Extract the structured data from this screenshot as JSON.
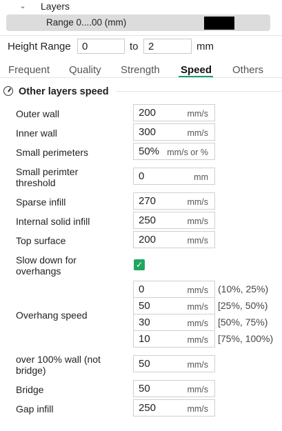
{
  "layers": {
    "title": "Layers",
    "range_label": "Range 0....00 (mm)"
  },
  "height_range": {
    "label": "Height Range",
    "from": "0",
    "to_label": "to",
    "to": "2",
    "unit": "mm"
  },
  "tabs": [
    "Frequent",
    "Quality",
    "Strength",
    "Speed",
    "Others"
  ],
  "active_tab": "Speed",
  "section": {
    "title": "Other layers speed"
  },
  "settings": {
    "outer_wall": {
      "label": "Outer wall",
      "value": "200",
      "unit": "mm/s"
    },
    "inner_wall": {
      "label": "Inner wall",
      "value": "300",
      "unit": "mm/s"
    },
    "small_perimeters": {
      "label": "Small perimeters",
      "value": "50%",
      "unit": "mm/s or %"
    },
    "small_perimeter_threshold": {
      "label_line1": "Small perimter",
      "label_line2": "threshold",
      "value": "0",
      "unit": "mm"
    },
    "sparse_infill": {
      "label": "Sparse infill",
      "value": "270",
      "unit": "mm/s"
    },
    "internal_solid_infill": {
      "label": "Internal solid infill",
      "value": "250",
      "unit": "mm/s"
    },
    "top_surface": {
      "label": "Top surface",
      "value": "200",
      "unit": "mm/s"
    },
    "slow_down_overhangs": {
      "label_line1": "Slow down for",
      "label_line2": "overhangs",
      "checked": true
    },
    "overhang_speed": {
      "label": "Overhang speed",
      "rows": [
        {
          "value": "0",
          "unit": "mm/s",
          "range": "(10%, 25%)"
        },
        {
          "value": "50",
          "unit": "mm/s",
          "range": "[25%, 50%)"
        },
        {
          "value": "30",
          "unit": "mm/s",
          "range": "[50%, 75%)"
        },
        {
          "value": "10",
          "unit": "mm/s",
          "range": "[75%, 100%)"
        }
      ]
    },
    "over_100_wall": {
      "label_line1": "over 100% wall (not",
      "label_line2": "bridge)",
      "value": "50",
      "unit": "mm/s"
    },
    "bridge": {
      "label": "Bridge",
      "value": "50",
      "unit": "mm/s"
    },
    "gap_infill": {
      "label": "Gap infill",
      "value": "250",
      "unit": "mm/s"
    }
  },
  "colors": {
    "accent": "#1a9e6a",
    "checkbox": "#1fa760",
    "range_bar": "#dcdcdc",
    "swatch": "#000000"
  }
}
